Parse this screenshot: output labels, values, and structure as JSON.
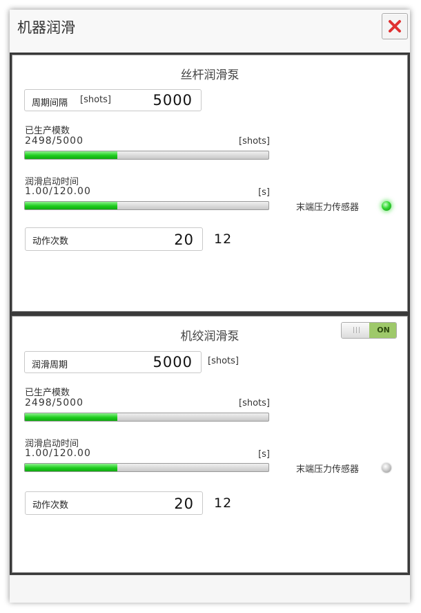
{
  "dialog": {
    "title": "机器润滑"
  },
  "panel1": {
    "title": "丝杆润滑泵",
    "interval": {
      "label": "周期间隔",
      "unit": "[shots]",
      "value": "5000"
    },
    "produced": {
      "label": "已生产模数",
      "text": "2498/5000",
      "unit": "[shots]",
      "fraction": 0.38
    },
    "lube_time": {
      "label": "润滑启动时间",
      "text": "1.00/120.00",
      "unit": "[s]",
      "fraction": 0.38
    },
    "sensor": {
      "label": "末端压力传感器",
      "state": "on"
    },
    "actions": {
      "label": "动作次数",
      "value": "20",
      "count": "12"
    }
  },
  "panel2": {
    "title": "机绞润滑泵",
    "toggle": {
      "label": "ON",
      "grip": "|||"
    },
    "interval": {
      "label": "润滑周期",
      "unit": "[shots]",
      "value": "5000"
    },
    "produced": {
      "label": "已生产模数",
      "text": "2498/5000",
      "unit": "[shots]",
      "fraction": 0.38
    },
    "lube_time": {
      "label": "润滑启动时间",
      "text": "1.00/120.00",
      "unit": "[s]",
      "fraction": 0.38
    },
    "sensor": {
      "label": "末端压力传感器",
      "state": "off"
    },
    "actions": {
      "label": "动作次数",
      "value": "20",
      "count": "12"
    }
  },
  "colors": {
    "accent_green": "#1dcc1d",
    "close_red": "#e03030",
    "toggle_on": "#9ec96a"
  }
}
